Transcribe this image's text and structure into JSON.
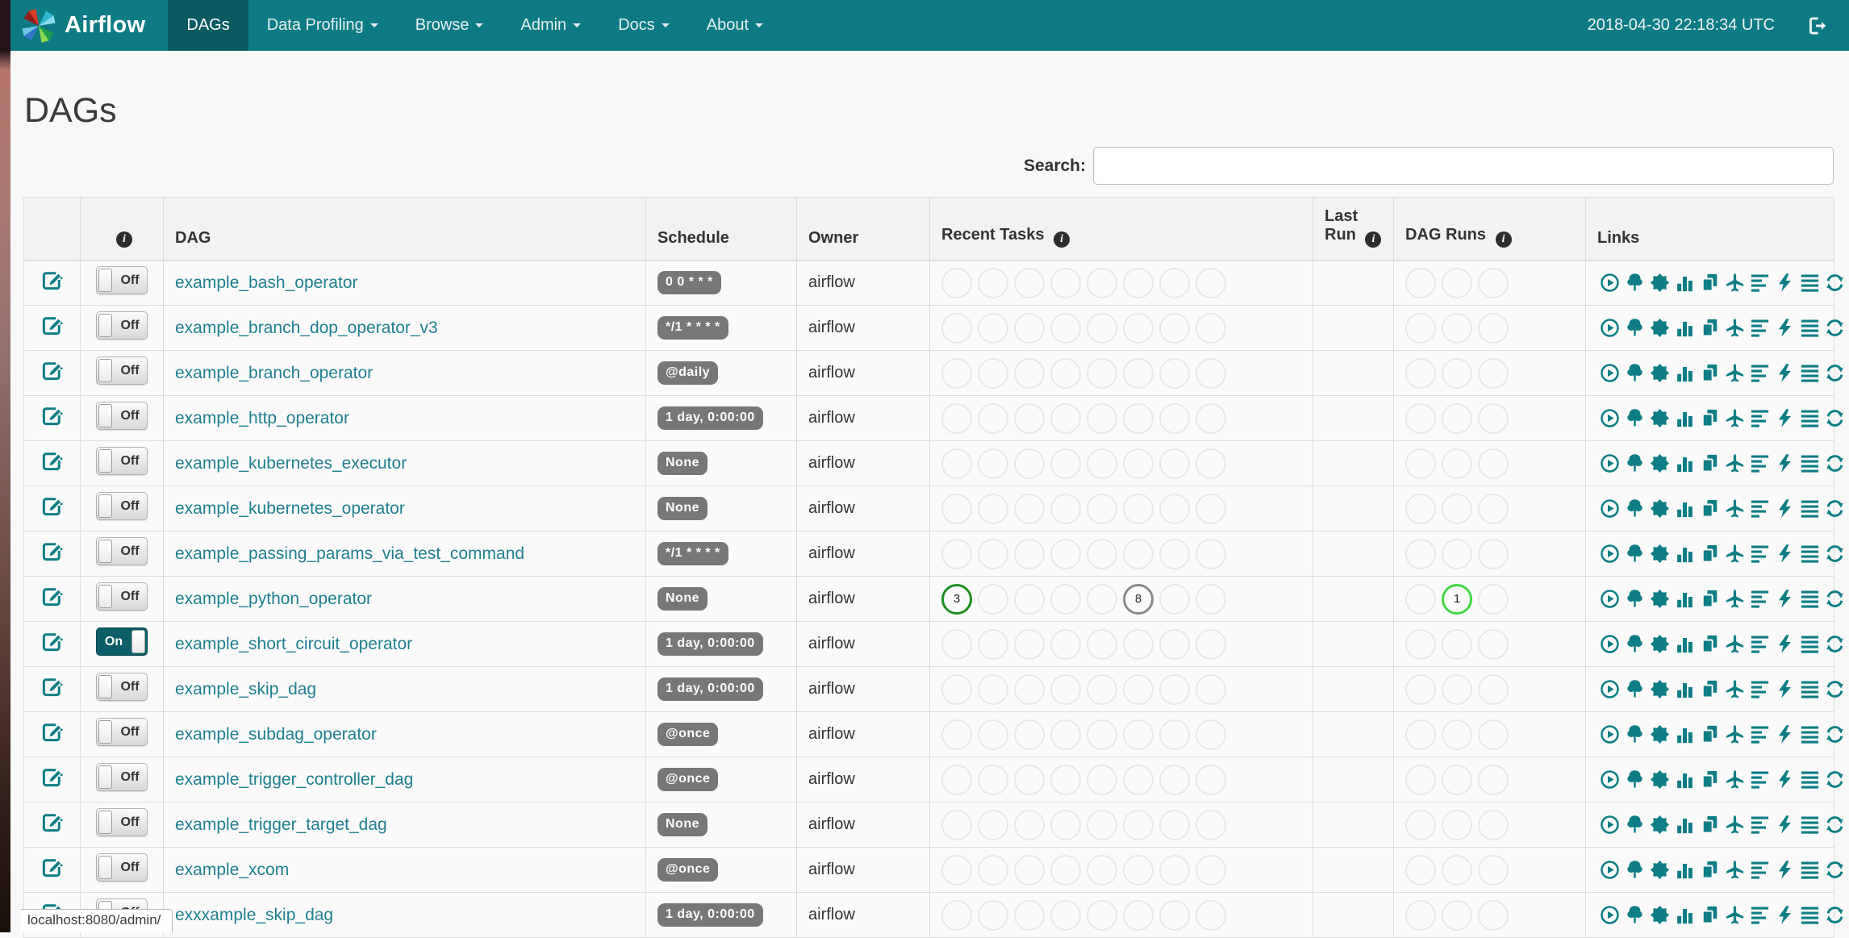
{
  "navbar": {
    "brand": "Airflow",
    "items": [
      {
        "label": "DAGs",
        "active": true,
        "dropdown": false
      },
      {
        "label": "Data Profiling",
        "active": false,
        "dropdown": true
      },
      {
        "label": "Browse",
        "active": false,
        "dropdown": true
      },
      {
        "label": "Admin",
        "active": false,
        "dropdown": true
      },
      {
        "label": "Docs",
        "active": false,
        "dropdown": true
      },
      {
        "label": "About",
        "active": false,
        "dropdown": true
      }
    ],
    "clock": "2018-04-30 22:18:34 UTC",
    "logout_icon": "sign-out-icon"
  },
  "page": {
    "title": "DAGs",
    "search_label": "Search:",
    "search_value": ""
  },
  "table": {
    "headers": {
      "info_icon": "i",
      "dag": "DAG",
      "schedule": "Schedule",
      "owner": "Owner",
      "recent_tasks": "Recent Tasks",
      "last_run": "Last Run",
      "dag_runs": "DAG Runs",
      "links": "Links"
    },
    "recent_task_slots": 8,
    "dag_run_slots": 3,
    "state_colors": {
      "success": "#1e8e1e",
      "shutdown": "#8a8a8a",
      "running": "#43d843",
      "empty": "#e8e8e8"
    },
    "link_actions": [
      {
        "name": "trigger-dag",
        "icon": "play-circle-icon"
      },
      {
        "name": "tree-view",
        "icon": "tree-icon"
      },
      {
        "name": "graph-view",
        "icon": "sunburst-icon"
      },
      {
        "name": "tasks-duration",
        "icon": "bar-chart-icon"
      },
      {
        "name": "task-tries",
        "icon": "copy-icon"
      },
      {
        "name": "landing-times",
        "icon": "plane-icon"
      },
      {
        "name": "gantt",
        "icon": "align-left-icon"
      },
      {
        "name": "code-view",
        "icon": "bolt-icon"
      },
      {
        "name": "logs",
        "icon": "align-justify-icon"
      },
      {
        "name": "refresh",
        "icon": "refresh-icon"
      }
    ],
    "rows": [
      {
        "name": "example_bash_operator",
        "toggle": "Off",
        "schedule": "0 0 * * *",
        "owner": "airflow",
        "recent_tasks": [],
        "dag_runs": []
      },
      {
        "name": "example_branch_dop_operator_v3",
        "toggle": "Off",
        "schedule": "*/1 * * * *",
        "owner": "airflow",
        "recent_tasks": [],
        "dag_runs": []
      },
      {
        "name": "example_branch_operator",
        "toggle": "Off",
        "schedule": "@daily",
        "owner": "airflow",
        "recent_tasks": [],
        "dag_runs": []
      },
      {
        "name": "example_http_operator",
        "toggle": "Off",
        "schedule": "1 day, 0:00:00",
        "owner": "airflow",
        "recent_tasks": [],
        "dag_runs": []
      },
      {
        "name": "example_kubernetes_executor",
        "toggle": "Off",
        "schedule": "None",
        "owner": "airflow",
        "recent_tasks": [],
        "dag_runs": []
      },
      {
        "name": "example_kubernetes_operator",
        "toggle": "Off",
        "schedule": "None",
        "owner": "airflow",
        "recent_tasks": [],
        "dag_runs": []
      },
      {
        "name": "example_passing_params_via_test_command",
        "toggle": "Off",
        "schedule": "*/1 * * * *",
        "owner": "airflow",
        "recent_tasks": [],
        "dag_runs": []
      },
      {
        "name": "example_python_operator",
        "toggle": "Off",
        "schedule": "None",
        "owner": "airflow",
        "recent_tasks": [
          {
            "slot": 0,
            "count": "3",
            "state": "success"
          },
          {
            "slot": 5,
            "count": "8",
            "state": "shutdown"
          }
        ],
        "dag_runs": [
          {
            "slot": 1,
            "count": "1",
            "state": "running"
          }
        ]
      },
      {
        "name": "example_short_circuit_operator",
        "toggle": "On",
        "schedule": "1 day, 0:00:00",
        "owner": "airflow",
        "recent_tasks": [],
        "dag_runs": []
      },
      {
        "name": "example_skip_dag",
        "toggle": "Off",
        "schedule": "1 day, 0:00:00",
        "owner": "airflow",
        "recent_tasks": [],
        "dag_runs": []
      },
      {
        "name": "example_subdag_operator",
        "toggle": "Off",
        "schedule": "@once",
        "owner": "airflow",
        "recent_tasks": [],
        "dag_runs": []
      },
      {
        "name": "example_trigger_controller_dag",
        "toggle": "Off",
        "schedule": "@once",
        "owner": "airflow",
        "recent_tasks": [],
        "dag_runs": []
      },
      {
        "name": "example_trigger_target_dag",
        "toggle": "Off",
        "schedule": "None",
        "owner": "airflow",
        "recent_tasks": [],
        "dag_runs": []
      },
      {
        "name": "example_xcom",
        "toggle": "Off",
        "schedule": "@once",
        "owner": "airflow",
        "recent_tasks": [],
        "dag_runs": []
      },
      {
        "name": "exxxample_skip_dag",
        "toggle": "Off",
        "schedule": "1 day, 0:00:00",
        "owner": "airflow",
        "recent_tasks": [],
        "dag_runs": []
      }
    ]
  },
  "status_bar": {
    "url": "localhost:8080/admin/"
  }
}
